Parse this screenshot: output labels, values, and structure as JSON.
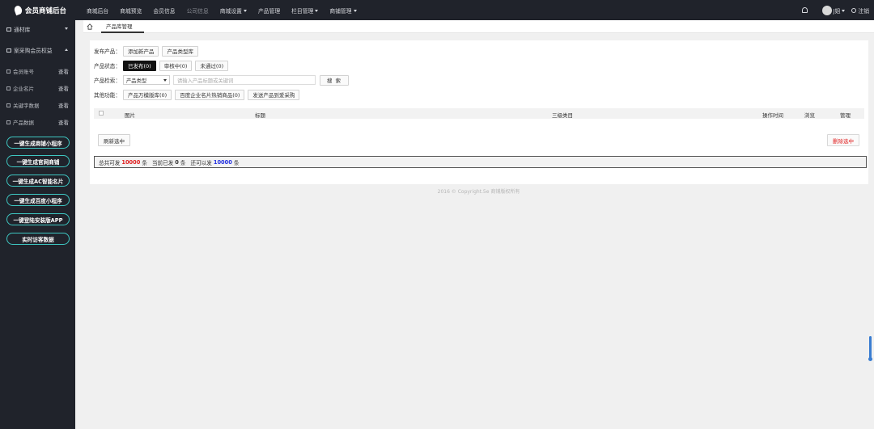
{
  "app": {
    "title": "会员商铺后台"
  },
  "topnav": {
    "items": [
      "商城后台",
      "商城预览",
      "会员信息",
      "公司信息",
      "商城设置",
      "产品管理",
      "栏目管理",
      "商铺管理"
    ],
    "dim_item": "公司信息",
    "user": "J姐",
    "logout": "注销"
  },
  "sidebar": {
    "group1": "通材库",
    "group2": "案采购会员权益",
    "items": [
      {
        "label": "会员账号",
        "action": "查看"
      },
      {
        "label": "企业名片",
        "action": "查看"
      },
      {
        "label": "关键字数据",
        "action": "查看"
      },
      {
        "label": "产品数据",
        "action": "查看"
      }
    ],
    "pills": [
      "一键生成商铺小程序",
      "一键生成官网商铺",
      "一键生成AC智能名片",
      "一键生成百度小程序",
      "一键登陆安装版APP",
      "实时访客数据"
    ]
  },
  "tabs": {
    "active": "产品库管理"
  },
  "filters": {
    "publish_label": "发布产品：",
    "publish_buttons": [
      "添加新产品",
      "产品类型库"
    ],
    "status_label": "产品状态：",
    "status_buttons": [
      "已发布(0)",
      "审核中(0)",
      "未通过(0)"
    ],
    "search_label": "产品检索：",
    "search_select": "产品类型",
    "search_placeholder": "请输入产品标题或关键词",
    "search_button": "搜 索",
    "other_label": "其他功能：",
    "other_buttons": [
      "产品万模版库(0)",
      "百度企业名片热销商品(0)",
      "发送产品到爱采购"
    ]
  },
  "table": {
    "columns": [
      "图片",
      "标题",
      "三级类目",
      "操作时间",
      "浏览",
      "管理"
    ]
  },
  "actions": {
    "refresh": "刷新选中",
    "delete": "删除选中"
  },
  "summary": {
    "total_label": "总共可发",
    "total_value": "10000",
    "unit": "条",
    "current_label": "当前已发",
    "current_value": "0",
    "remain_label": "还可以发",
    "remain_value": "10000"
  },
  "footer": {
    "copyright": "2016 © Copyright.5e 商铺版权所有"
  },
  "colors": {
    "sidebar_bg": "#20232b",
    "accent_teal": "#3ec7c2",
    "danger": "#e02020",
    "info": "#2230e0"
  }
}
